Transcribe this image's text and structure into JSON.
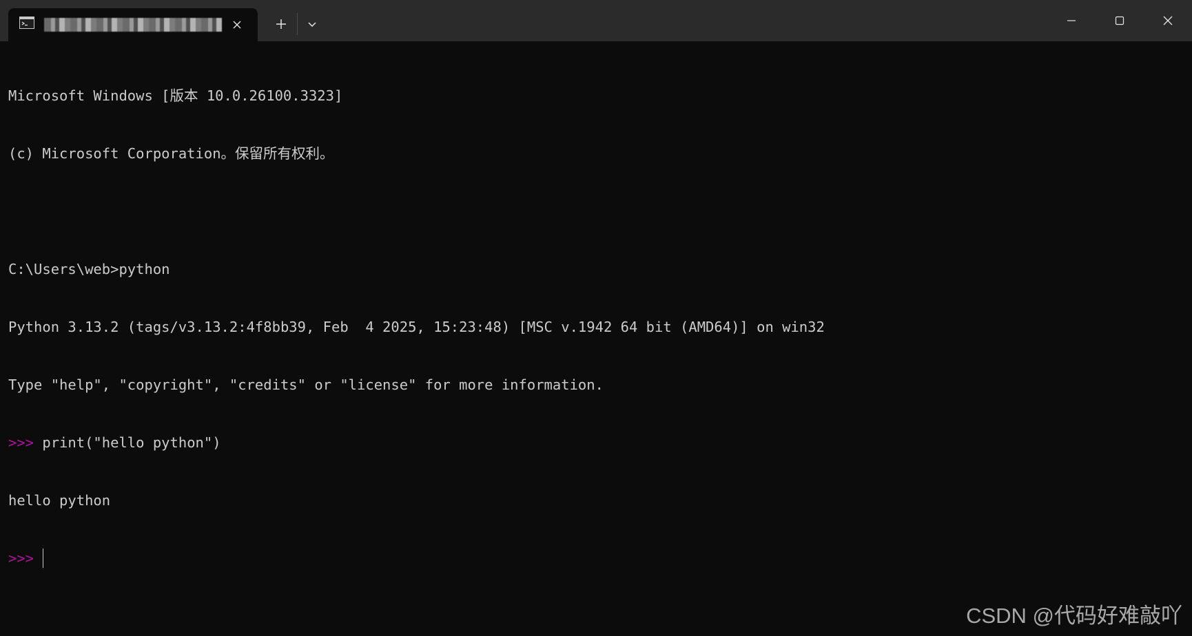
{
  "window": {
    "tab_title": "",
    "icons": {
      "tab": "terminal-icon",
      "close_tab": "close-icon",
      "new_tab": "plus-icon",
      "dropdown": "chevron-down-icon",
      "minimize": "minimize-icon",
      "maximize": "maximize-icon",
      "close": "close-icon"
    }
  },
  "terminal": {
    "colors": {
      "background": "#0c0c0c",
      "foreground": "#cccccc",
      "prompt": "#b20f9e"
    },
    "lines": {
      "l1": "Microsoft Windows [版本 10.0.26100.3323]",
      "l2": "(c) Microsoft Corporation。保留所有权利。",
      "l4": "C:\\Users\\web>python",
      "l5": "Python 3.13.2 (tags/v3.13.2:4f8bb39, Feb  4 2025, 15:23:48) [MSC v.1942 64 bit (AMD64)] on win32",
      "l6": "Type \"help\", \"copyright\", \"credits\" or \"license\" for more information.",
      "l7_prompt": ">>>",
      "l7_cmd": " print(\"hello python\")",
      "l8": "hello python",
      "l9_prompt": ">>>",
      "l9_input": " "
    }
  },
  "watermark": "CSDN @代码好难敲吖"
}
